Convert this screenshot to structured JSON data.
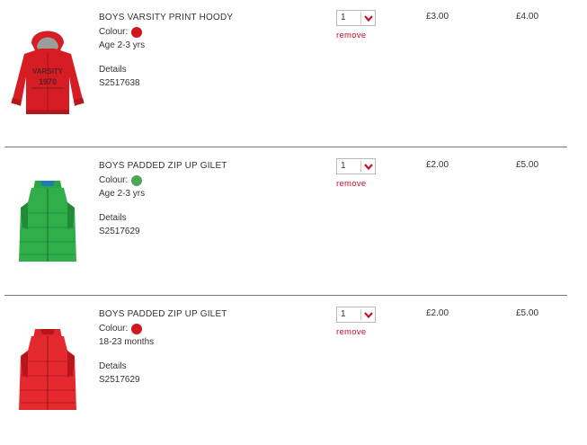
{
  "items": [
    {
      "name": "BOYS VARSITY PRINT HOODY",
      "colour_label": "Colour:",
      "colour_hex": "#d0161f",
      "size": "Age 2-3 yrs",
      "details_label": "Details",
      "sku": "S2517638",
      "quantity": "1",
      "remove_label": "remove",
      "unit_price": "£3.00",
      "total_price": "£4.00",
      "image_icon": "red-varsity-hoody-image"
    },
    {
      "name": "BOYS PADDED ZIP UP GILET",
      "colour_label": "Colour:",
      "colour_hex": "#52a45c",
      "size": "Age 2-3 yrs",
      "details_label": "Details",
      "sku": "S2517629",
      "quantity": "1",
      "remove_label": "remove",
      "unit_price": "£2.00",
      "total_price": "£5.00",
      "image_icon": "green-padded-gilet-image"
    },
    {
      "name": "BOYS PADDED ZIP UP GILET",
      "colour_label": "Colour:",
      "colour_hex": "#d0161f",
      "size": "18-23 months",
      "details_label": "Details",
      "sku": "S2517629",
      "quantity": "1",
      "remove_label": "remove",
      "unit_price": "£2.00",
      "total_price": "£5.00",
      "image_icon": "red-padded-gilet-image"
    }
  ],
  "accent_color": "#c8102e"
}
